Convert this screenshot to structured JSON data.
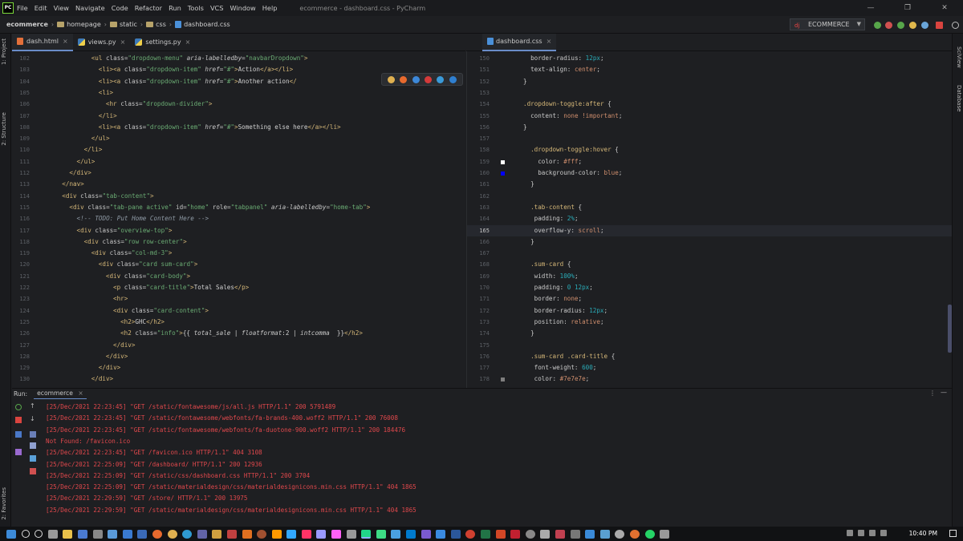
{
  "app": {
    "logo_text": "PC",
    "menu": [
      "File",
      "Edit",
      "View",
      "Navigate",
      "Code",
      "Refactor",
      "Run",
      "Tools",
      "VCS",
      "Window",
      "Help"
    ],
    "window_title": "ecommerce - dashboard.css - PyCharm",
    "win_min": "—",
    "win_max": "❐",
    "win_close": "✕"
  },
  "breadcrumb": {
    "project": "ecommerce",
    "items": [
      "homepage",
      "static",
      "css",
      "dashboard.css"
    ]
  },
  "run_config": {
    "name": "ECOMMERCE"
  },
  "left_strip": {
    "project_tab": "1: Project",
    "structure_tab": "2: Structure",
    "favorites_tab": "2: Favorites"
  },
  "right_strip": {
    "sciview_tab": "SciView",
    "database_tab": "Database"
  },
  "left_tabs": [
    {
      "label": "dash.html",
      "type": "html"
    },
    {
      "label": "views.py",
      "type": "py"
    },
    {
      "label": "settings.py",
      "type": "py"
    }
  ],
  "right_tabs": [
    {
      "label": "dashboard.css",
      "type": "css"
    }
  ],
  "html_lines": [
    {
      "n": "102",
      "indent": 14,
      "html": "<span class='tag'>&lt;ul</span> <span class='aname'>class=</span><span class='str'>\"dropdown-menu\"</span> <span class='aname' style='font-style:italic'>aria-labelledby=</span><span class='str'>\"navbarDropdown\"</span><span class='tag'>&gt;</span>"
    },
    {
      "n": "103",
      "indent": 16,
      "html": "<span class='tag'>&lt;li&gt;&lt;a</span> <span class='aname'>class=</span><span class='str'>\"dropdown-item\"</span> <span class='aname' style='font-style:italic'>href=</span><span class='str'>\"#\"</span><span class='tag'>&gt;</span><span class='txt'>Action</span><span class='tag'>&lt;/a&gt;&lt;/li&gt;</span>"
    },
    {
      "n": "104",
      "indent": 16,
      "html": "<span class='tag'>&lt;li&gt;&lt;a</span> <span class='aname'>class=</span><span class='str'>\"dropdown-item\"</span> <span class='aname' style='font-style:italic'>href=</span><span class='str'>\"#\"</span><span class='tag'>&gt;</span><span class='txt'>Another action</span><span class='tag'>&lt;/</span>"
    },
    {
      "n": "105",
      "indent": 16,
      "html": "<span class='tag'>&lt;li&gt;</span>"
    },
    {
      "n": "106",
      "indent": 18,
      "html": "<span class='tag'>&lt;hr</span> <span class='aname'>class=</span><span class='str'>\"dropdown-divider\"</span><span class='tag'>&gt;</span>"
    },
    {
      "n": "107",
      "indent": 16,
      "html": "<span class='tag'>&lt;/li&gt;</span>"
    },
    {
      "n": "108",
      "indent": 16,
      "html": "<span class='tag'>&lt;li&gt;&lt;a</span> <span class='aname'>class=</span><span class='str'>\"dropdown-item\"</span> <span class='aname' style='font-style:italic'>href=</span><span class='str'>\"#\"</span><span class='tag'>&gt;</span><span class='txt'>Something else here</span><span class='tag'>&lt;/a&gt;&lt;/li&gt;</span>"
    },
    {
      "n": "109",
      "indent": 14,
      "html": "<span class='tag'>&lt;/ul&gt;</span>"
    },
    {
      "n": "110",
      "indent": 12,
      "html": "<span class='tag'>&lt;/li&gt;</span>"
    },
    {
      "n": "111",
      "indent": 10,
      "html": "<span class='tag'>&lt;/ul&gt;</span>"
    },
    {
      "n": "112",
      "indent": 8,
      "html": "<span class='tag'>&lt;/div&gt;</span>"
    },
    {
      "n": "113",
      "indent": 6,
      "html": "<span class='tag'>&lt;/nav&gt;</span>"
    },
    {
      "n": "114",
      "indent": 6,
      "html": "<span class='tag'>&lt;div</span> <span class='aname'>class=</span><span class='str'>\"tab-content\"</span><span class='tag'>&gt;</span>"
    },
    {
      "n": "115",
      "indent": 8,
      "html": "<span class='tag'>&lt;div</span> <span class='aname'>class=</span><span class='str'>\"tab-pane active\"</span> <span class='aname'>id=</span><span class='str'>\"home\"</span> <span class='aname'>role=</span><span class='str'>\"tabpanel\"</span> <span class='aname' style='font-style:italic'>aria-labelledby=</span><span class='str'>\"home-tab\"</span><span class='tag'>&gt;</span>"
    },
    {
      "n": "116",
      "indent": 10,
      "html": "<span class='cmt'>&lt;!-- TODO: Put Home Content Here --&gt;</span>"
    },
    {
      "n": "117",
      "indent": 10,
      "html": "<span class='tag'>&lt;div</span> <span class='aname'>class=</span><span class='str'>\"overview-top\"</span><span class='tag'>&gt;</span>"
    },
    {
      "n": "118",
      "indent": 12,
      "html": "<span class='tag'>&lt;div</span> <span class='aname'>class=</span><span class='str'>\"row row-center\"</span><span class='tag'>&gt;</span>"
    },
    {
      "n": "119",
      "indent": 14,
      "html": "<span class='tag'>&lt;div</span> <span class='aname'>class=</span><span class='str'>\"col-md-3\"</span><span class='tag'>&gt;</span>"
    },
    {
      "n": "120",
      "indent": 16,
      "html": "<span class='tag'>&lt;div</span> <span class='aname'>class=</span><span class='str'>\"card sum-card\"</span><span class='tag'>&gt;</span>"
    },
    {
      "n": "121",
      "indent": 18,
      "html": "<span class='tag'>&lt;div</span> <span class='aname'>class=</span><span class='str'>\"card-body\"</span><span class='tag'>&gt;</span>"
    },
    {
      "n": "122",
      "indent": 20,
      "html": "<span class='tag'>&lt;p</span> <span class='aname'>class=</span><span class='str'>\"card-title\"</span><span class='tag'>&gt;</span><span class='txt'>Total Sales</span><span class='tag'>&lt;/p&gt;</span>"
    },
    {
      "n": "123",
      "indent": 20,
      "html": "<span class='tag'>&lt;hr&gt;</span>"
    },
    {
      "n": "124",
      "indent": 20,
      "html": "<span class='tag'>&lt;div</span> <span class='aname'>class=</span><span class='str'>\"card-content\"</span><span class='tag'>&gt;</span>"
    },
    {
      "n": "125",
      "indent": 22,
      "html": "<span class='tag'>&lt;h2&gt;</span><span class='txt'>GHC</span><span class='tag'>&lt;/h2&gt;</span>"
    },
    {
      "n": "126",
      "indent": 22,
      "html": "<span class='tag'>&lt;h2</span> <span class='aname'>class=</span><span class='str'>\"info\"</span><span class='tag'>&gt;</span><span class='txt'>{{ </span><span class='cmt' style='color:#c8c8c8'>total_sale</span><span class='txt'> | </span><span class='cmt' style='color:#c8c8c8'>floatformat</span><span class='txt'>:2 | </span><span class='cmt' style='color:#c8c8c8'>intcomma</span><span class='txt'>  }}</span><span class='tag'>&lt;/h2&gt;</span>"
    },
    {
      "n": "127",
      "indent": 20,
      "html": "<span class='tag'>&lt;/div&gt;</span>"
    },
    {
      "n": "128",
      "indent": 18,
      "html": "<span class='tag'>&lt;/div&gt;</span>"
    },
    {
      "n": "129",
      "indent": 16,
      "html": "<span class='tag'>&lt;/div&gt;</span>"
    },
    {
      "n": "130",
      "indent": 14,
      "html": "<span class='tag'>&lt;/div&gt;</span>"
    }
  ],
  "css_lines": [
    {
      "n": "150",
      "indent": 2,
      "html": "<span class='prop'>border-radius: </span><span class='num'>12px</span><span class='prop'>;</span>"
    },
    {
      "n": "151",
      "indent": 2,
      "html": "<span class='prop'>text-align: </span><span class='val'>center</span><span class='prop'>;</span>"
    },
    {
      "n": "152",
      "indent": 0,
      "html": "<span class='brace'>}</span>"
    },
    {
      "n": "153",
      "indent": 0,
      "html": ""
    },
    {
      "n": "154",
      "indent": 0,
      "html": "<span class='sel'>.dropdown-toggle:after</span> <span class='brace'>{</span>"
    },
    {
      "n": "155",
      "indent": 2,
      "html": "<span class='prop'>content: </span><span class='val'>none !important</span><span class='prop'>;</span>"
    },
    {
      "n": "156",
      "indent": 0,
      "html": "<span class='brace'>}</span>"
    },
    {
      "n": "157",
      "indent": 0,
      "html": ""
    },
    {
      "n": "158",
      "indent": 2,
      "html": "<span class='sel'>.dropdown-toggle:hover</span> <span class='brace'>{</span>"
    },
    {
      "n": "159",
      "indent": 4,
      "html": "<span class='prop'>color: </span><span class='val'>#fff</span><span class='prop'>;</span>"
    },
    {
      "n": "160",
      "indent": 4,
      "html": "<span class='prop'>background-color: </span><span class='val'>blue</span><span class='prop'>;</span>"
    },
    {
      "n": "161",
      "indent": 2,
      "html": "<span class='brace'>}</span>"
    },
    {
      "n": "162",
      "indent": 0,
      "html": ""
    },
    {
      "n": "163",
      "indent": 2,
      "html": "<span class='sel'>.tab-content</span> <span class='brace'>{</span>"
    },
    {
      "n": "164",
      "indent": 3,
      "html": "<span class='prop'>padding: </span><span class='num'>2%</span><span class='prop'>;</span>"
    },
    {
      "n": "165",
      "indent": 3,
      "html": "<span class='prop'>overflow-y: </span><span class='val'>scroll</span><span class='prop'>;</span>"
    },
    {
      "n": "166",
      "indent": 2,
      "html": "<span class='brace'>}</span>"
    },
    {
      "n": "167",
      "indent": 0,
      "html": ""
    },
    {
      "n": "168",
      "indent": 2,
      "html": "<span class='sel'>.sum-card</span> <span class='brace'>{</span>"
    },
    {
      "n": "169",
      "indent": 3,
      "html": "<span class='prop'>width: </span><span class='num'>100%</span><span class='prop'>;</span>"
    },
    {
      "n": "170",
      "indent": 3,
      "html": "<span class='prop'>padding: </span><span class='num'>0 12px</span><span class='prop'>;</span>"
    },
    {
      "n": "171",
      "indent": 3,
      "html": "<span class='prop'>border: </span><span class='val'>none</span><span class='prop'>;</span>"
    },
    {
      "n": "172",
      "indent": 3,
      "html": "<span class='prop'>border-radius: </span><span class='num'>12px</span><span class='prop'>;</span>"
    },
    {
      "n": "173",
      "indent": 3,
      "html": "<span class='prop'>position: </span><span class='val'>relative</span><span class='prop'>;</span>"
    },
    {
      "n": "174",
      "indent": 2,
      "html": "<span class='brace'>}</span>"
    },
    {
      "n": "175",
      "indent": 0,
      "html": ""
    },
    {
      "n": "176",
      "indent": 2,
      "html": "<span class='sel'>.sum-card .card-title</span> <span class='brace'>{</span>"
    },
    {
      "n": "177",
      "indent": 3,
      "html": "<span class='prop'>font-weight: </span><span class='num'>600</span><span class='prop'>;</span>"
    },
    {
      "n": "178",
      "indent": 3,
      "html": "<span class='prop'>color: </span><span class='val'>#7e7e7e</span><span class='prop'>;</span>"
    }
  ],
  "current_css_line": "165",
  "run": {
    "label": "Run:",
    "tab": "ecommerce",
    "logs": [
      "[25/Dec/2021 22:23:45] \"GET /static/fontawesome/js/all.js HTTP/1.1\" 200 5791489",
      "[25/Dec/2021 22:23:45] \"GET /static/fontawesome/webfonts/fa-brands-400.woff2 HTTP/1.1\" 200 76008",
      "[25/Dec/2021 22:23:45] \"GET /static/fontawesome/webfonts/fa-duotone-900.woff2 HTTP/1.1\" 200 184476",
      "Not Found: /favicon.ico",
      "[25/Dec/2021 22:23:45] \"GET /favicon.ico HTTP/1.1\" 404 3108",
      "[25/Dec/2021 22:25:09] \"GET /dashboard/ HTTP/1.1\" 200 12936",
      "[25/Dec/2021 22:25:09] \"GET /static/css/dashboard.css HTTP/1.1\" 200 3704",
      "[25/Dec/2021 22:25:09] \"GET /static/materialdesign/css/materialdesignicons.min.css HTTP/1.1\" 404 1865",
      "[25/Dec/2021 22:29:59] \"GET /store/ HTTP/1.1\" 200 13975",
      "[25/Dec/2021 22:29:59] \"GET /static/materialdesign/css/materialdesignicons.min.css HTTP/1.1\" 404 1865"
    ]
  },
  "taskbar": {
    "clock": "10:40 PM"
  },
  "colors": {
    "log_red": "#e0484c",
    "accent": "#6a8cc8"
  }
}
